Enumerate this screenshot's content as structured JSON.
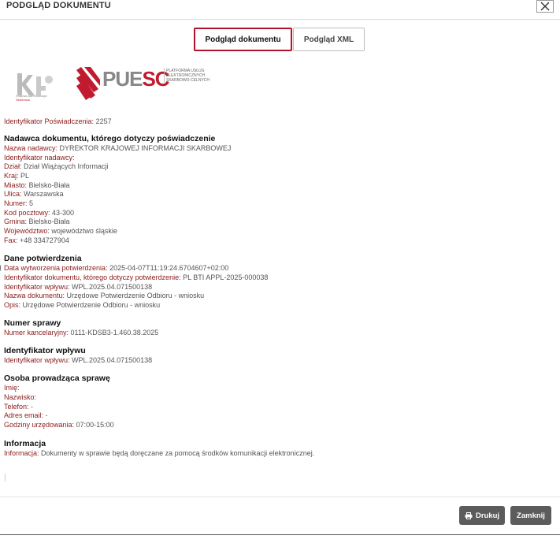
{
  "header": {
    "title": "PODGLĄD DOKUMENTU"
  },
  "tabs": [
    {
      "label": "Podgląd dokumentu"
    },
    {
      "label": "Podgląd XML"
    }
  ],
  "logos": {
    "kas_caption_line1": "Krajowa Administracja",
    "kas_caption_line2": "Skarbowa",
    "puesc_part1": "PUE",
    "puesc_part2": "SC",
    "puesc_sub": "PLATFORMA USŁUG ELEKTRONICZNYCH SKARBOWO-CELNYCH",
    "brand_red": "#c11b2f"
  },
  "doc": {
    "cert_id": {
      "label": "Identyfikator Poświadczenia:",
      "value": " 2257"
    },
    "sender": {
      "heading": "Nadawca dokumentu, którego dotyczy poświadczenie",
      "fields": [
        {
          "label": "Nazwa nadawcy:",
          "value": " DYREKTOR KRAJOWEJ INFORMACJI SKARBOWEJ"
        },
        {
          "label": "Identyfikator nadawcy:",
          "value": ""
        },
        {
          "label": "Dział:",
          "value": " Dział Wiążących Informacji"
        },
        {
          "label": "Kraj:",
          "value": " PL"
        },
        {
          "label": "Miasto:",
          "value": " Bielsko-Biała"
        },
        {
          "label": "Ulica:",
          "value": " Warszawska"
        },
        {
          "label": "Numer:",
          "value": " 5"
        },
        {
          "label": "Kod pocztowy:",
          "value": " 43-300"
        },
        {
          "label": "Gmina:",
          "value": " Bielsko-Biała"
        },
        {
          "label": "Województwo:",
          "value": " województwo śląskie"
        },
        {
          "label": "Fax:",
          "value": " +48 334727904"
        }
      ]
    },
    "confirmation": {
      "heading": "Dane potwierdzenia",
      "fields": [
        {
          "label": "Data wytworzenia potwierdzenia:",
          "value": " 2025-04-07T11:19:24.6704607+02:00"
        },
        {
          "label": "Identyfikator dokumentu, którego dotyczy potwierdzenie:",
          "value": " PL BTI APPL-2025-000038"
        },
        {
          "label": "Identyfikator wpływu:",
          "value": " WPL.2025.04.071500138"
        },
        {
          "label": "Nazwa dokumentu:",
          "value": " Urzędowe Potwierdzenie Odbioru - wniosku"
        },
        {
          "label": "Opis:",
          "value": " Urzędowe Potwierdzenie Odbioru - wniosku"
        }
      ]
    },
    "case_number": {
      "heading": "Numer sprawy",
      "fields": [
        {
          "label": "Numer kancelaryjny:",
          "value": " 0111-KDSB3-1.460.38.2025"
        }
      ]
    },
    "receipt_id": {
      "heading": "Identyfikator wpływu",
      "fields": [
        {
          "label": "Identyfikator wpływu:",
          "value": " WPL.2025.04.071500138"
        }
      ]
    },
    "handler": {
      "heading": "Osoba prowadząca sprawę",
      "fields": [
        {
          "label": "Imię:",
          "value": ""
        },
        {
          "label": "Nazwisko:",
          "value": ""
        },
        {
          "label": "Telefon:",
          "value": " -"
        },
        {
          "label": "Adres email:",
          "value": " -"
        },
        {
          "label": "Godziny urzędowania:",
          "value": " 07:00-15:00"
        }
      ]
    },
    "info": {
      "heading": "Informacja",
      "fields": [
        {
          "label": "Informacja:",
          "value": " Dokumenty w sprawie będą doręczane za pomocą środków komunikacji elektronicznej."
        }
      ]
    }
  },
  "footer": {
    "print_label": "Drukuj",
    "close_label": "Zamknij"
  },
  "colors": {
    "accent": "#b3122c",
    "label": "#8b1a1a",
    "button": "#5c5c5c"
  },
  "icons": {
    "close": "close-icon",
    "print": "print-icon"
  }
}
